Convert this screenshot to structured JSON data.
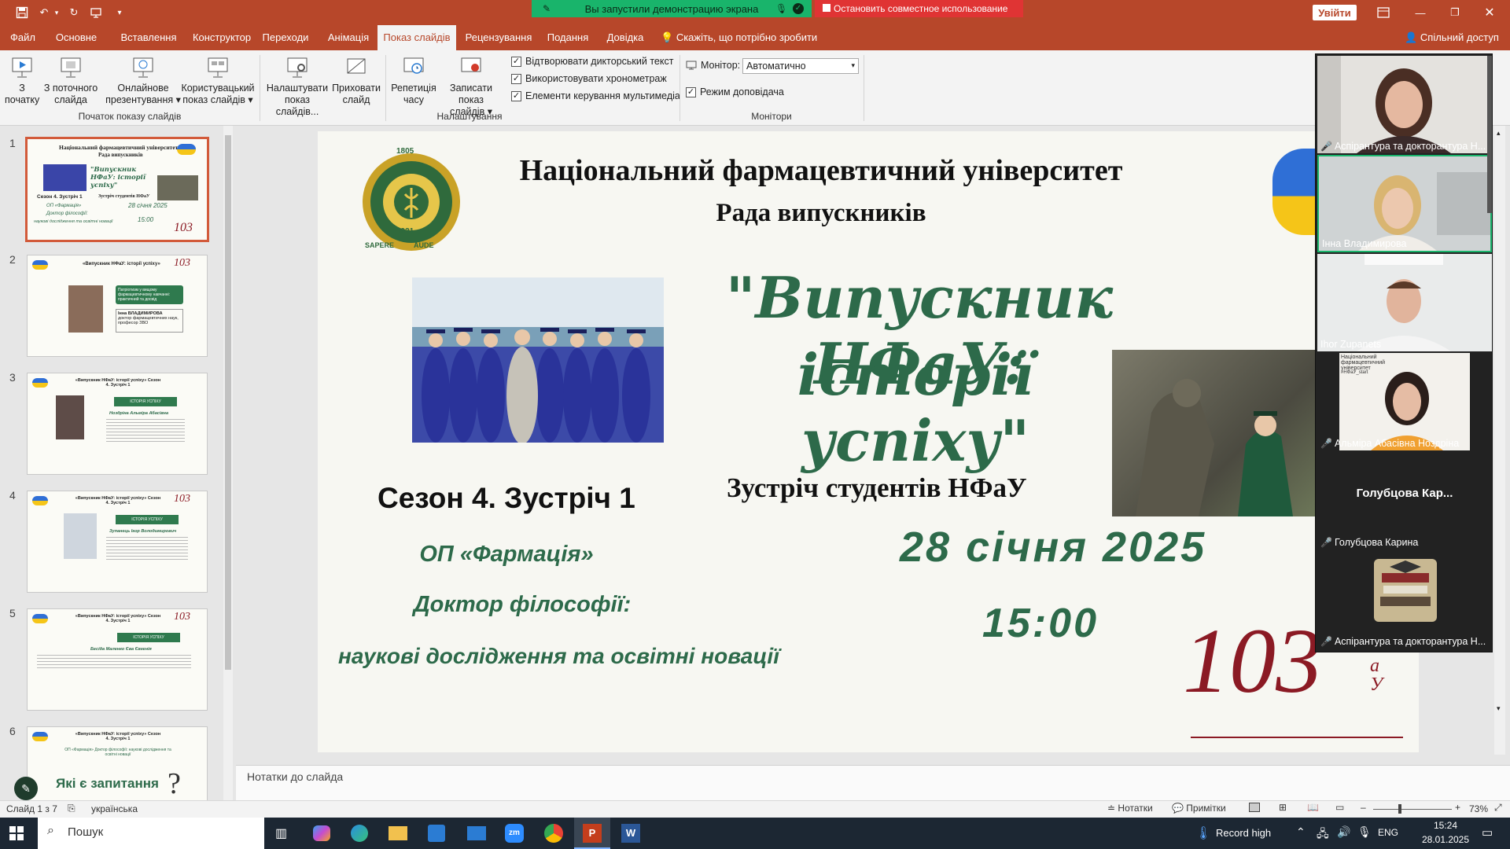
{
  "titlebar": {
    "share_status": "Вы запустили демонстрацию экрана",
    "stop_share": "Остановить совместное использование",
    "login": "Увійти"
  },
  "tabs": [
    "Файл",
    "Основне",
    "Вставлення",
    "Конструктор",
    "Переходи",
    "Анімація",
    "Показ слайдів",
    "Рецензування",
    "Подання",
    "Довідка",
    "Скажіть, що потрібно зробити"
  ],
  "active_tab": "Показ слайдів",
  "share_access": "Спільний доступ",
  "ribbon": {
    "from_start": [
      "З",
      "початку"
    ],
    "from_current": [
      "З поточного",
      "слайда"
    ],
    "online": [
      "Онлайнове",
      "презентування ▾"
    ],
    "custom": [
      "Користувацький",
      "показ слайдів ▾"
    ],
    "setup": [
      "Налаштувати",
      "показ слайдів..."
    ],
    "hide": [
      "Приховати",
      "слайд"
    ],
    "rehearse": [
      "Репетиція",
      "часу"
    ],
    "record": [
      "Записати показ",
      "слайдів ▾"
    ],
    "group_start": "Початок показу слайдів",
    "group_setup": "Налаштування",
    "group_monitors": "Монітори",
    "chk_narration": "Відтворювати дикторський текст",
    "chk_timings": "Використовувати хронометраж",
    "chk_media": "Елементи керування мультимедіа",
    "monitor_label": "Монітор:",
    "monitor_value": "Автоматично",
    "presenter_view": "Режим доповідача"
  },
  "thumbnails": {
    "numbers": [
      "1",
      "2",
      "3",
      "4",
      "5",
      "6"
    ],
    "t1_title": "Національний фармацевтичний університет",
    "t1_sub": "Рада випускників",
    "t1_script": "\"Випускник НФаУ: історії успіху\"",
    "t1_season": "Сезон 4. Зустріч 1",
    "t1_meet": "Зустріч студентів НФаУ",
    "t1_op": "ОП «Фармація»",
    "t1_phd": "Доктор філософії:",
    "t1_research": "наукові дослідження та освітні новації",
    "t1_date": "28 січня 2025",
    "t1_time": "15:00",
    "t2_head": "«Випускник НФаУ: історії успіху»",
    "t2_badge": "Патріотизм у вищому фармацевтичному навчанні: практичний та досвід",
    "t2_name": "Інна ВЛАДИМИРОВА",
    "t2_role": "доктор фармацевтичних наук, професор ЗВО",
    "t3_head": "«Випускник НФаУ: історії успіху» Сезон 4. Зустріч 1",
    "t3_badge": "ІСТОРІЯ УСПІХУ",
    "t3_name": "Ноздріна Альміра Абасівна",
    "t4_head": "«Випускник НФаУ: історії успіху» Сезон 4. Зустріч 1",
    "t4_badge": "ІСТОРІЯ УСПІХУ",
    "t4_name": "Зупанець Ігор Володимирович",
    "t5_head": "«Випускник НФаУ: історії успіху» Сезон 4. Зустріч 1",
    "t5_badge": "ІСТОРІЯ УСПІХУ",
    "t5_name": "Бесіда Маленко Єва Євгенія",
    "t6_head": "«Випускник НФаУ: історії успіху» Сезон 4. Зустріч 1",
    "t6_sub": "ОП «Фармація» Доктор філософії: наукові дослідження та освітні новації",
    "t6_q": "Які є запитання",
    "t_brand": "103"
  },
  "slide": {
    "univ": "Національний фармацевтичний університет",
    "council": "Рада випускників",
    "script1": "\"Випускник НФаУ:",
    "script2": "історії успіху\"",
    "season": "Сезон 4. Зустріч 1",
    "meeting": "Зустріч студентів НФаУ",
    "program": "ОП «Фармація»",
    "phd": "Доктор філософії:",
    "research": "наукові дослідження та освітні новації",
    "date": "28 січня 2025",
    "time": "15:00",
    "logo_year": "1805",
    "logo_year2": "1921",
    "logo_motto_left": "SAPERE",
    "logo_motto_right": "AUDE",
    "brand_num": "103",
    "brand_letters": "НФаУ"
  },
  "notes_placeholder": "Нотатки до слайда",
  "status": {
    "slide": "Слайд 1 з 7",
    "lang": "українська",
    "notes": "Нотатки",
    "comments": "Примітки",
    "zoom": "73%"
  },
  "zoom": {
    "tiles": [
      {
        "name": "Аспірантура та докторантура Н...",
        "muted": true
      },
      {
        "name": "Інна Владимирова",
        "muted": false
      },
      {
        "name": "Ihor Zupanets",
        "muted": false
      },
      {
        "name": "Альміра Абасівна Ноздріна",
        "muted": true
      },
      {
        "name": "Голубцова Карина",
        "muted": true
      },
      {
        "name": "Аспірантура та докторантура Н...",
        "muted": true
      }
    ],
    "big_name": "Голубцова Кар...",
    "shared_small_title": "Національний фармацевтичний університет",
    "shared_small_tag": "#НФаУ_start"
  },
  "taskbar": {
    "search": "Пошук",
    "record": "Record high",
    "lang": "ENG",
    "time": "15:24",
    "date": "28.01.2025"
  },
  "colors": {
    "accent": "#b7472a",
    "slide_green": "#2d6a4a",
    "zoom_green": "#19b46b",
    "stop_red": "#e03434",
    "brand": "#8b1a24"
  }
}
